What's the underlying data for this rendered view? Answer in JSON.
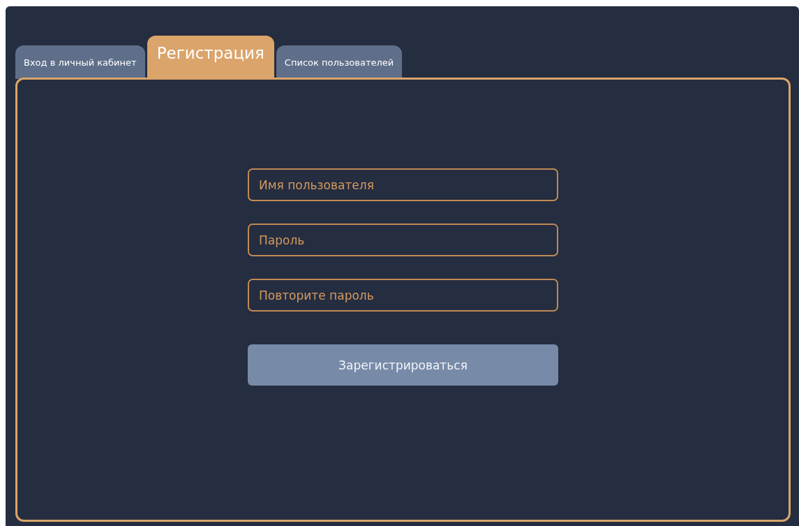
{
  "tabs": [
    {
      "label": "Вход в личный кабинет",
      "selected": false
    },
    {
      "label": "Регистрация",
      "selected": true
    },
    {
      "label": "Список пользователей",
      "selected": false
    }
  ],
  "form": {
    "fields": [
      {
        "placeholder": "Имя пользователя"
      },
      {
        "placeholder": "Пароль"
      },
      {
        "placeholder": "Повторите пароль"
      }
    ],
    "submit": "Зарегистрироваться"
  }
}
